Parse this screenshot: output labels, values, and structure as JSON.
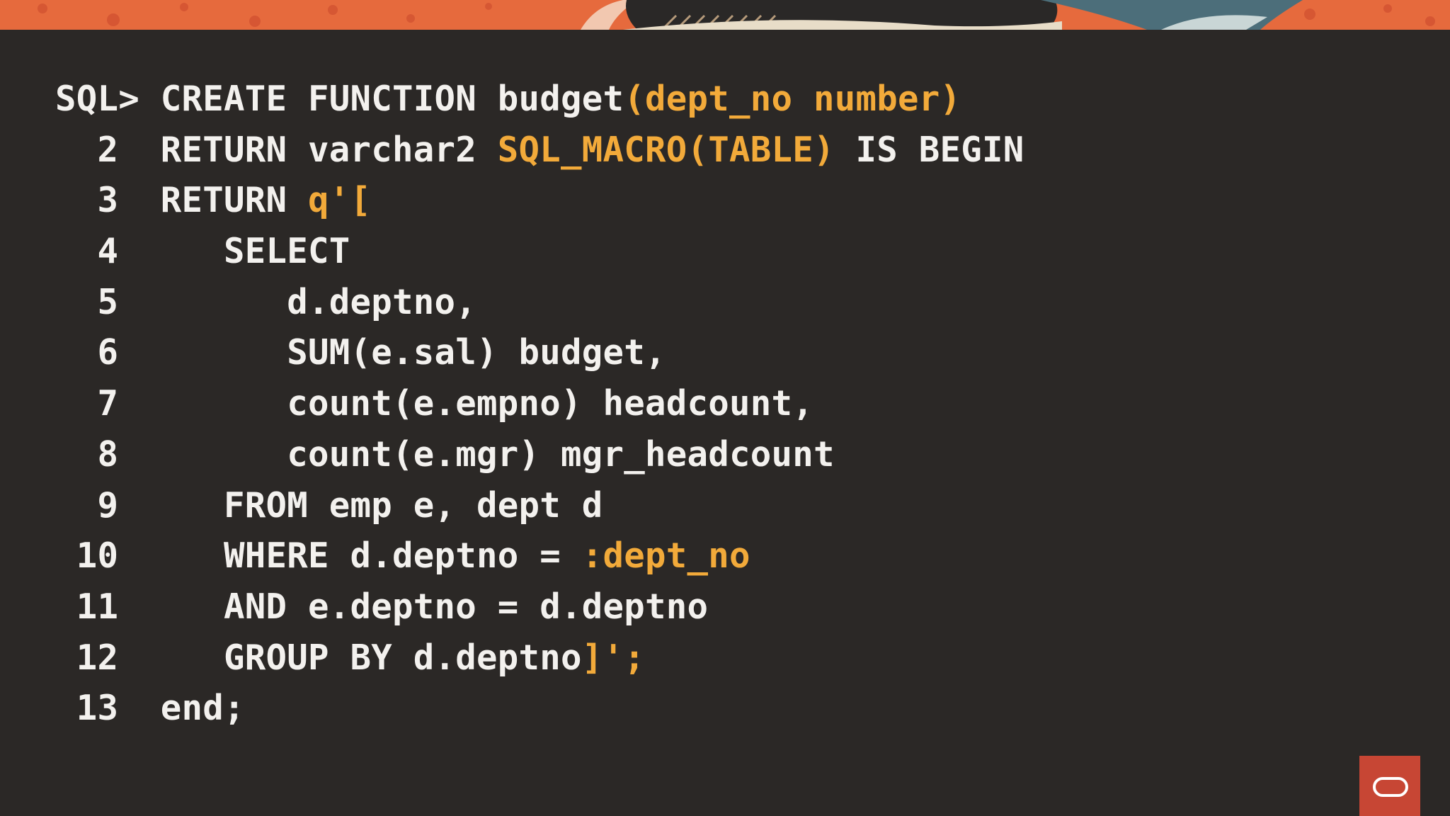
{
  "colors": {
    "background": "#2b2826",
    "text": "#f3f1ee",
    "highlight": "#f2aa3a",
    "banner_orange": "#e0623a",
    "logo_red": "#c74634"
  },
  "code": {
    "lines": [
      {
        "segments": [
          {
            "text": "SQL> CREATE FUNCTION budget",
            "color": "text"
          },
          {
            "text": "(dept_no number)",
            "color": "highlight"
          }
        ]
      },
      {
        "segments": [
          {
            "text": "  2  RETURN varchar2 ",
            "color": "text"
          },
          {
            "text": "SQL_MACRO(TABLE)",
            "color": "highlight"
          },
          {
            "text": " IS BEGIN",
            "color": "text"
          }
        ]
      },
      {
        "segments": [
          {
            "text": "  3  RETURN ",
            "color": "text"
          },
          {
            "text": "q'[",
            "color": "highlight"
          }
        ]
      },
      {
        "segments": [
          {
            "text": "  4     SELECT",
            "color": "text"
          }
        ]
      },
      {
        "segments": [
          {
            "text": "  5        d.deptno,",
            "color": "text"
          }
        ]
      },
      {
        "segments": [
          {
            "text": "  6        SUM(e.sal) budget,",
            "color": "text"
          }
        ]
      },
      {
        "segments": [
          {
            "text": "  7        count(e.empno) headcount,",
            "color": "text"
          }
        ]
      },
      {
        "segments": [
          {
            "text": "  8        count(e.mgr) mgr_headcount",
            "color": "text"
          }
        ]
      },
      {
        "segments": [
          {
            "text": "  9     FROM emp e, dept d",
            "color": "text"
          }
        ]
      },
      {
        "segments": [
          {
            "text": " 10     WHERE d.deptno = ",
            "color": "text"
          },
          {
            "text": ":dept_no",
            "color": "highlight"
          }
        ]
      },
      {
        "segments": [
          {
            "text": " 11     AND e.deptno = d.deptno",
            "color": "text"
          }
        ]
      },
      {
        "segments": [
          {
            "text": " 12     GROUP BY d.deptno",
            "color": "text"
          },
          {
            "text": "]';",
            "color": "highlight"
          }
        ]
      },
      {
        "segments": [
          {
            "text": " 13  end;",
            "color": "text"
          }
        ]
      }
    ]
  },
  "branding": {
    "logo_icon": "oracle-logo-icon"
  }
}
